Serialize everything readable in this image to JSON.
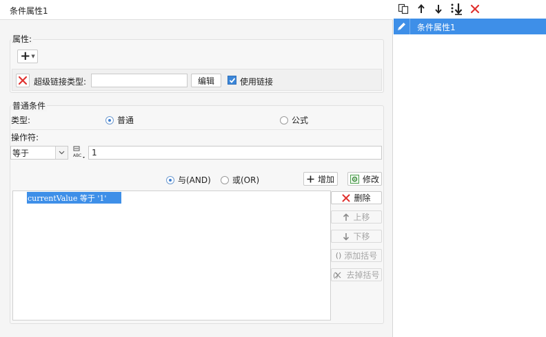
{
  "dialog": {
    "title": "条件属性1"
  },
  "attributes": {
    "section_label": "属性:",
    "add_button_glyph": "+",
    "hyperlink_type_label": "超级链接类型:",
    "hyperlink_type_value": "",
    "edit_button": "编辑",
    "use_link_label": "使用链接",
    "use_link_checked": true
  },
  "common_condition": {
    "section_label": "普通条件",
    "type_label": "类型:",
    "type_options": [
      "普通",
      "公式"
    ],
    "type_selected": "普通",
    "operator_label": "操作符:",
    "operator_value": "等于",
    "value_input": "1",
    "logic_and": "与(AND)",
    "logic_or": "或(OR)",
    "logic_selected": "与(AND)",
    "add_button": "增加",
    "modify_button": "修改",
    "delete_button": "删除",
    "move_up_button": "上移",
    "move_down_button": "下移",
    "add_bracket_button": "添加括号",
    "remove_bracket_button": "去掉括号",
    "condition_items": [
      "currentValue 等于 '1'"
    ]
  },
  "right_panel": {
    "list_items": [
      "条件属性1"
    ]
  },
  "colors": {
    "accent": "#3e8fe8",
    "delete_red": "#e0322f",
    "checkbox_blue": "#3b86d8"
  }
}
